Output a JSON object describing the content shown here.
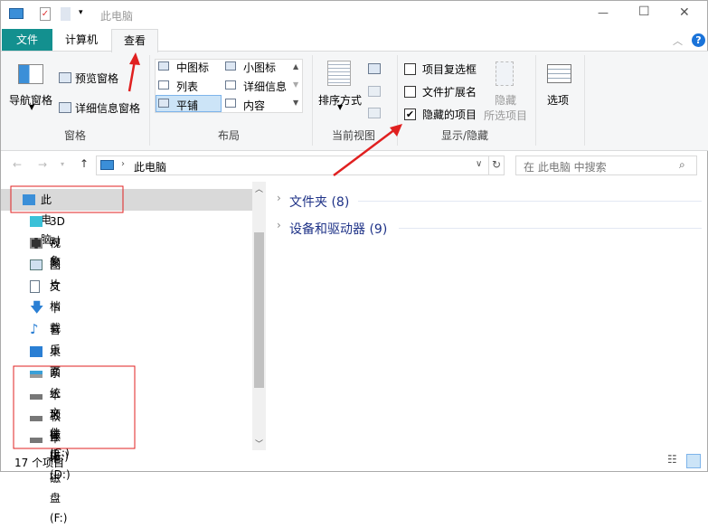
{
  "window": {
    "title": "此电脑",
    "minimize": "—",
    "maximize": "☐",
    "close": "✕"
  },
  "tabs": [
    {
      "label": "文件"
    },
    {
      "label": "计算机"
    },
    {
      "label": "查看"
    }
  ],
  "ribbon": {
    "panes": {
      "nav_pane": "导航窗格",
      "preview_pane": "预览窗格",
      "details_pane": "详细信息窗格",
      "group": "窗格"
    },
    "layout": {
      "items": [
        "中图标",
        "小图标",
        "列表",
        "详细信息",
        "平铺",
        "内容"
      ],
      "selected": "平铺",
      "group": "布局"
    },
    "current_view": {
      "sort": "排序方式",
      "group": "当前视图"
    },
    "show_hide": {
      "item_checkboxes": {
        "label": "项目复选框",
        "checked": false
      },
      "file_extensions": {
        "label": "文件扩展名",
        "checked": false
      },
      "hidden_items": {
        "label": "隐藏的项目",
        "checked": true
      },
      "hide_selected_1": "隐藏",
      "hide_selected_2": "所选项目",
      "group": "显示/隐藏"
    },
    "options": "选项"
  },
  "address": {
    "path": "此电脑",
    "search_placeholder": "在 此电脑 中搜索"
  },
  "nav": {
    "items": [
      {
        "label": "此电脑"
      },
      {
        "label": "3D 对象"
      },
      {
        "label": "视频"
      },
      {
        "label": "图片"
      },
      {
        "label": "文档"
      },
      {
        "label": "下载"
      },
      {
        "label": "音乐"
      },
      {
        "label": "桌面"
      },
      {
        "label": "系统文件 (C:)"
      },
      {
        "label": "本地磁盘 (D:)"
      },
      {
        "label": "软件 (E:)"
      },
      {
        "label": "本地磁盘 (F:)"
      }
    ]
  },
  "content": {
    "groups": [
      {
        "label": "文件夹 (8)"
      },
      {
        "label": "设备和驱动器 (9)"
      }
    ]
  },
  "status": {
    "count": "17 个项目"
  }
}
